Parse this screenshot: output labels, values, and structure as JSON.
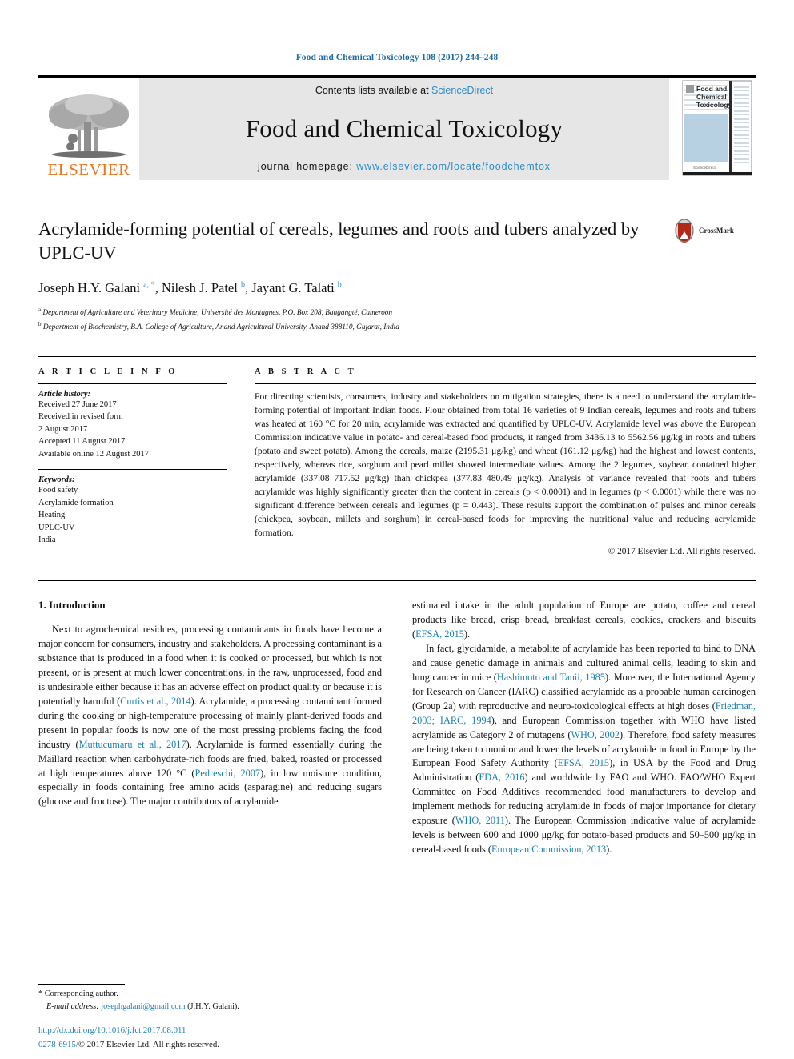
{
  "running_head": "Food and Chemical Toxicology 108 (2017) 244–248",
  "banner": {
    "publisher_logo_text": "ELSEVIER",
    "contents_prefix": "Contents lists available at ",
    "contents_link": "ScienceDirect",
    "journal_title": "Food and Chemical Toxicology",
    "homepage_prefix": "journal homepage: ",
    "homepage_url": "www.elsevier.com/locate/foodchemtox",
    "cover_title_line1": "Food and",
    "cover_title_line2": "Chemical",
    "cover_title_line3": "Toxicology"
  },
  "article": {
    "title": "Acrylamide-forming potential of cereals, legumes and roots and tubers analyzed by UPLC-UV",
    "crossmark_label": "CrossMark",
    "authors_html": "Joseph H.Y. Galani <sup>a, *</sup>, Nilesh J. Patel <sup>b</sup>, Jayant G. Talati <sup>b</sup>",
    "affiliations": [
      {
        "marker": "a",
        "text": "Department of Agriculture and Veterinary Medicine, Université des Montagnes, P.O. Box 208, Bangangté, Cameroon"
      },
      {
        "marker": "b",
        "text": "Department of Biochemistry, B.A. College of Agriculture, Anand Agricultural University, Anand 388110, Gujarat, India"
      }
    ]
  },
  "article_info": {
    "heading": "A R T I C L E  I N F O",
    "history_label": "Article history:",
    "history": [
      "Received 27 June 2017",
      "Received in revised form",
      "2 August 2017",
      "Accepted 11 August 2017",
      "Available online 12 August 2017"
    ],
    "keywords_label": "Keywords:",
    "keywords": [
      "Food safety",
      "Acrylamide formation",
      "Heating",
      "UPLC-UV",
      "India"
    ]
  },
  "abstract": {
    "heading": "A B S T R A C T",
    "text": "For directing scientists, consumers, industry and stakeholders on mitigation strategies, there is a need to understand the acrylamide-forming potential of important Indian foods. Flour obtained from total 16 varieties of 9 Indian cereals, legumes and roots and tubers was heated at 160 °C for 20 min, acrylamide was extracted and quantified by UPLC-UV. Acrylamide level was above the European Commission indicative value in potato- and cereal-based food products, it ranged from 3436.13 to 5562.56 μg/kg in roots and tubers (potato and sweet potato). Among the cereals, maize (2195.31 μg/kg) and wheat (161.12 μg/kg) had the highest and lowest contents, respectively, whereas rice, sorghum and pearl millet showed intermediate values. Among the 2 legumes, soybean contained higher acrylamide (337.08–717.52 μg/kg) than chickpea (377.83–480.49 μg/kg). Analysis of variance revealed that roots and tubers acrylamide was highly significantly greater than the content in cereals (p < 0.0001) and in legumes (p < 0.0001) while there was no significant difference between cereals and legumes (p = 0.443). These results support the combination of pulses and minor cereals (chickpea, soybean, millets and sorghum) in cereal-based foods for improving the nutritional value and reducing acrylamide formation.",
    "copyright": "© 2017 Elsevier Ltd. All rights reserved."
  },
  "introduction": {
    "heading": "1. Introduction",
    "left_para_1_html": "Next to agrochemical residues, processing contaminants in foods have become a major concern for consumers, industry and stakeholders. A processing contaminant is a substance that is produced in a food when it is cooked or processed, but which is not present, or is present at much lower concentrations, in the raw, unprocessed, food and is undesirable either because it has an adverse effect on product quality or because it is potentially harmful (<span class=\"ref\">Curtis et al., 2014</span>). Acrylamide, a processing contaminant formed during the cooking or high-temperature processing of mainly plant-derived foods and present in popular foods is now one of the most pressing problems facing the food industry (<span class=\"ref\">Muttucumaru et al., 2017</span>). Acrylamide is formed essentially during the Maillard reaction when carbohydrate-rich foods are fried, baked, roasted or processed at high temperatures above 120 °C (<span class=\"ref\">Pedreschi, 2007</span>), in low moisture condition, especially in foods containing free amino acids (asparagine) and reducing sugars (glucose and fructose). The major contributors of acrylamide",
    "right_para_1_html": "estimated intake in the adult population of Europe are potato, coffee and cereal products like bread, crisp bread, breakfast cereals, cookies, crackers and biscuits (<span class=\"ref\">EFSA, 2015</span>).",
    "right_para_2_html": "In fact, glycidamide, a metabolite of acrylamide has been reported to bind to DNA and cause genetic damage in animals and cultured animal cells, leading to skin and lung cancer in mice (<span class=\"ref\">Hashimoto and Tanii, 1985</span>). Moreover, the International Agency for Research on Cancer (IARC) classified acrylamide as a probable human carcinogen (Group 2a) with reproductive and neuro-toxicological effects at high doses (<span class=\"ref\">Friedman, 2003; IARC, 1994</span>), and European Commission together with WHO have listed acrylamide as Category 2 of mutagens (<span class=\"ref\">WHO, 2002</span>). Therefore, food safety measures are being taken to monitor and lower the levels of acrylamide in food in Europe by the European Food Safety Authority (<span class=\"ref\">EFSA, 2015</span>), in USA by the Food and Drug Administration (<span class=\"ref\">FDA, 2016</span>) and worldwide by FAO and WHO. FAO/WHO Expert Committee on Food Additives recommended food manufacturers to develop and implement methods for reducing acrylamide in foods of major importance for dietary exposure (<span class=\"ref\">WHO, 2011</span>). The European Commission indicative value of acrylamide levels is between 600 and 1000 μg/kg for potato-based products and 50–500 μg/kg in cereal-based foods (<span class=\"ref\">European Commission, 2013</span>)."
  },
  "footer": {
    "corresponding_marker": "*",
    "corresponding_label": "Corresponding author.",
    "email_label": "E-mail address:",
    "email": "josephgalani@gmail.com",
    "email_owner": "(J.H.Y. Galani).",
    "doi": "http://dx.doi.org/10.1016/j.fct.2017.08.011",
    "issn_prefix": "0278-6915/",
    "issn_rest": "© 2017 Elsevier Ltd. All rights reserved."
  },
  "colors": {
    "link_blue": "#1a7fb5",
    "header_blue": "#1a6ba8",
    "elsevier_orange": "#E87722",
    "banner_gray": "#e6e6e6",
    "crossmark_red": "#b02a18"
  }
}
